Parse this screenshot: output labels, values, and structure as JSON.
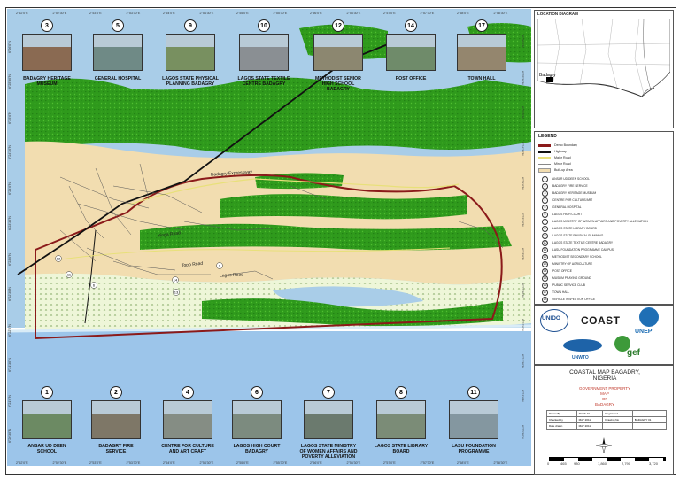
{
  "top_photos": [
    {
      "num": "3",
      "label": "BADAGRY HERITAGE MUSEUM",
      "label_lines": [
        "BADAGRY HERITAGE",
        "MUSEUM"
      ],
      "color": "#8a6a52"
    },
    {
      "num": "5",
      "label": "GENERAL HOSPITAL",
      "label_lines": [
        "GENERAL HOSPITAL"
      ],
      "color": "#6f8a86"
    },
    {
      "num": "9",
      "label": "LAGOS STATE PHYSICAL PLANNING BADAGRY",
      "label_lines": [
        "LAGOS STATE PHYSICAL",
        "PLANNING BADAGRY"
      ],
      "color": "#789060"
    },
    {
      "num": "10",
      "label": "LAGOS STATE TEXTILE CENTRE BADAGRY",
      "label_lines": [
        "LAGOS STATE TEXTILE",
        "CENTRE BADAGRY"
      ],
      "color": "#8a8f93"
    },
    {
      "num": "12",
      "label": "METHODIST SENIOR HIGH SCHOOL BADAGRY",
      "label_lines": [
        "METHODIST SENIOR",
        "HIGH SCHOOL",
        "BADAGRY"
      ],
      "color": "#8c8770"
    },
    {
      "num": "14",
      "label": "POST OFFICE",
      "label_lines": [
        "POST OFFICE"
      ],
      "color": "#6f8b6a"
    },
    {
      "num": "17",
      "label": "TOWN HALL",
      "label_lines": [
        "TOWN HALL"
      ],
      "color": "#94866e"
    }
  ],
  "bottom_photos": [
    {
      "num": "1",
      "label": "ANSAR UD DEEN SCHOOL",
      "label_lines": [
        "ANSAR UD DEEN",
        "SCHOOL"
      ],
      "color": "#6c8a63"
    },
    {
      "num": "2",
      "label": "BADAGRY FIRE SERVICE",
      "label_lines": [
        "BADAGRY FIRE",
        "SERVICE"
      ],
      "color": "#7e7767"
    },
    {
      "num": "4",
      "label": "CENTRE FOR CULTURE AND ART CRAFT",
      "label_lines": [
        "CENTRE FOR CULTURE",
        "AND ART CRAFT"
      ],
      "color": "#858d84"
    },
    {
      "num": "6",
      "label": "LAGOS HIGH COURT BADAGRY",
      "label_lines": [
        "LAGOS HIGH COURT",
        "BADAGRY"
      ],
      "color": "#7c8b7f"
    },
    {
      "num": "7",
      "label": "LAGOS STATE MINISTRY OF WOMEN AFFAIRS AND POVERTY ALLEVIATION",
      "label_lines": [
        "LAGOS STATE MINISTRY",
        "OF WOMEN AFFAIRS AND",
        "POVERTY ALLEVIATION"
      ],
      "color": "#6b7a6e"
    },
    {
      "num": "8",
      "label": "LAGOS STATE LIBRARY BOARD",
      "label_lines": [
        "LAGOS STATE LIBRARY",
        "BOARD"
      ],
      "color": "#7b8c77"
    },
    {
      "num": "11",
      "label": "LASU FOUNDATION PROGRAMME",
      "label_lines": [
        "LASU FOUNDATION",
        "PROGRAMME"
      ],
      "color": "#8497a0"
    }
  ],
  "map_labels": {
    "expressway": "Badagry Expressway",
    "road1": "Yinga Road",
    "road2": "Topo Road",
    "road3": "Lagos Road"
  },
  "coords_top": [
    "2°52'0\"E",
    "2°52'30\"E",
    "2°53'0\"E",
    "2°53'30\"E",
    "2°54'0\"E",
    "2°54'30\"E",
    "2°55'0\"E",
    "2°55'30\"E",
    "2°56'0\"E",
    "2°56'30\"E",
    "2°57'0\"E",
    "2°57'30\"E",
    "2°58'0\"E",
    "2°58'30\"E"
  ],
  "coords_left": [
    "6°26'0\"N",
    "6°25'30\"N",
    "6°25'0\"N",
    "6°24'30\"N",
    "6°24'0\"N",
    "6°23'30\"N",
    "6°23'0\"N",
    "6°22'30\"N",
    "6°22'0\"N",
    "6°21'30\"N",
    "6°21'0\"N",
    "6°20'30\"N"
  ],
  "location_diagram": {
    "title": "LOCATION DIAGRAM",
    "place": "Badagry"
  },
  "legend": {
    "title": "LEGEND",
    "items": [
      {
        "label": "Demo Boundary",
        "color": "#8b1a1a",
        "style": "line"
      },
      {
        "label": "Highway",
        "color": "#111111",
        "style": "line"
      },
      {
        "label": "Major Road",
        "color": "#e8e07a",
        "style": "line"
      },
      {
        "label": "Minor Road",
        "color": "#888888",
        "style": "thin"
      },
      {
        "label": "Built-up Area",
        "color": "#f2ddb0",
        "style": "box"
      }
    ],
    "places": [
      {
        "n": "1",
        "label": "ANSAR UD DEEN SCHOOL"
      },
      {
        "n": "2",
        "label": "BADAGRY FIRE SERVICE"
      },
      {
        "n": "3",
        "label": "BADAGRY HERITAGE MUSEUM"
      },
      {
        "n": "4",
        "label": "CENTRE FOR CULTURE/ART"
      },
      {
        "n": "5",
        "label": "GENERAL HOSPITAL"
      },
      {
        "n": "6",
        "label": "LAGOS HIGH COURT"
      },
      {
        "n": "7",
        "label": "LAGOS MINISTRY OF WOMEN AFFAIRS AND POVERTY ALLEVIATION"
      },
      {
        "n": "8",
        "label": "LAGOS STATE LIBRARY BOARD"
      },
      {
        "n": "9",
        "label": "LAGOS STATE PHYSICAL PLANNING"
      },
      {
        "n": "10",
        "label": "LAGOS STATE TEXTILE CENTRE BADAGRY"
      },
      {
        "n": "11",
        "label": "LASU FOUNDATION PROGRAMME CAMPUS"
      },
      {
        "n": "12",
        "label": "METHODIST SECONDARY SCHOOL"
      },
      {
        "n": "13",
        "label": "MINISTRY OF AGRICULTURE"
      },
      {
        "n": "14",
        "label": "POST OFFICE"
      },
      {
        "n": "15",
        "label": "MUSLIM PRAYING GROUND"
      },
      {
        "n": "16",
        "label": "PUBLIC SERVICE CLUB"
      },
      {
        "n": "17",
        "label": "TOWN HALL"
      },
      {
        "n": "18",
        "label": "VEHICLE INSPECTION OFFICE"
      }
    ]
  },
  "logos": {
    "unido": "UNIDO",
    "coast": "COAST",
    "unep": "UNEP",
    "unwto": "UNWTO",
    "gef": "gef"
  },
  "title_block": {
    "title_line1": "COASTAL MAP BAGADRY,",
    "title_line2": "NIGERIA",
    "gov_line1": "GOVERNMENT PROPERTY",
    "gov_line2": "MAP",
    "gov_line3": "OF",
    "gov_line4": "BADAGRY"
  },
  "info_table": [
    [
      "Drawn By",
      "ZONE 31",
      "Registered",
      ""
    ],
    [
      "Checked by",
      "MAY 2011",
      "Drawing No",
      "BADAGRY 01"
    ],
    [
      "Date drawn",
      "MAY 2011",
      "",
      ""
    ]
  ],
  "scale": {
    "labels": [
      "0",
      "465",
      "930",
      "1,860",
      "2,790",
      "3,720"
    ],
    "unit": "Meters"
  },
  "colors": {
    "water": "#9cc5ea",
    "lagoon": "#a9cde8",
    "vegetation": "#2f9a1c",
    "built": "#f2ddb0",
    "wetland": "#e6f2c8",
    "boundary": "#8b1a1a",
    "highway": "#111111",
    "major_road": "#e8e07a"
  }
}
